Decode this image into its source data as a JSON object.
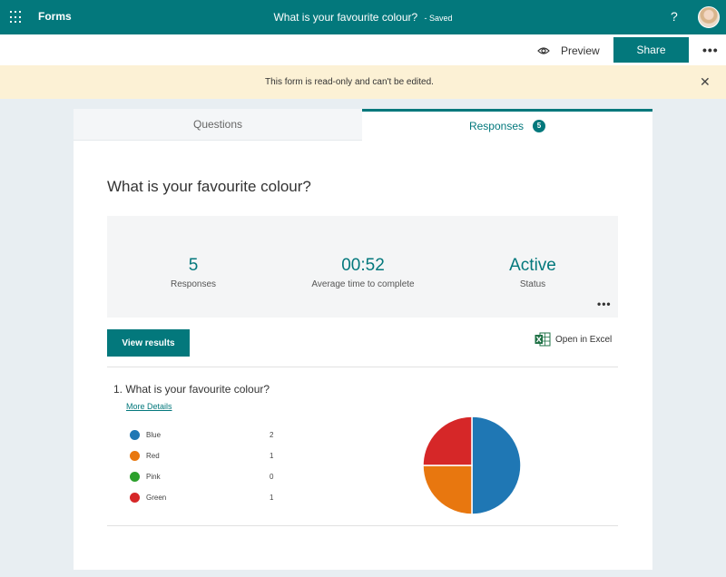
{
  "topbar": {
    "app_name": "Forms",
    "form_title": "What is your favourite colour?",
    "saved_label": "- Saved",
    "help_label": "?"
  },
  "commands": {
    "preview_label": "Preview",
    "share_label": "Share",
    "more_label": "•••"
  },
  "banner": {
    "message": "This form is read-only and can't be edited.",
    "close_label": "✕"
  },
  "tabs": {
    "questions_label": "Questions",
    "responses_label": "Responses",
    "responses_count": "5"
  },
  "form": {
    "title": "What is your favourite colour?"
  },
  "summary": {
    "responses": {
      "value": "5",
      "label": "Responses"
    },
    "avg_time": {
      "value": "00:52",
      "label": "Average time to complete"
    },
    "status": {
      "value": "Active",
      "label": "Status"
    },
    "more_label": "•••"
  },
  "actions": {
    "view_results_label": "View results",
    "open_excel_label": "Open in Excel"
  },
  "question": {
    "title": "1.  What is your favourite colour?",
    "more_details_label": "More Details"
  },
  "colors": {
    "accent": "#03787c",
    "banner": "#fcf1d5",
    "blue": "#1f77b4",
    "red": "#e8770f",
    "pink": "#2ca02c",
    "green": "#d62728"
  },
  "chart_data": {
    "type": "pie",
    "categories": [
      "Blue",
      "Red",
      "Pink",
      "Green"
    ],
    "values": [
      2,
      1,
      0,
      1
    ],
    "colors": [
      "#1f77b4",
      "#e8770f",
      "#2ca02c",
      "#d62728"
    ],
    "title": ""
  }
}
